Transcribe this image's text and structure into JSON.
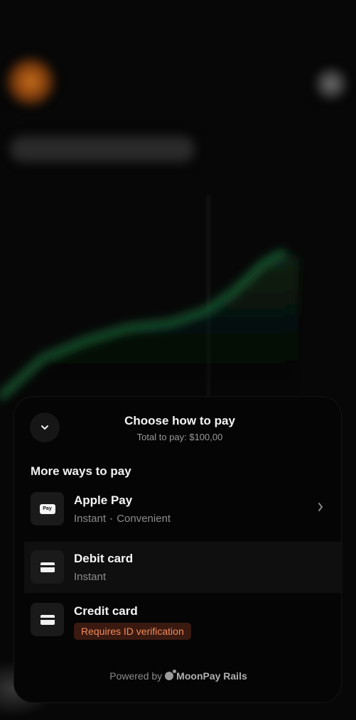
{
  "sheet": {
    "title": "Choose how to pay",
    "subtitle": "Total to pay: $100,00",
    "section_title": "More ways to pay",
    "options": [
      {
        "label": "Apple Pay",
        "meta_primary": "Instant",
        "meta_separator": "•",
        "meta_secondary": "Convenient",
        "icon": "apple-pay-icon",
        "icon_text": "Pay"
      },
      {
        "label": "Debit card",
        "meta_primary": "Instant",
        "icon": "card-icon"
      },
      {
        "label": "Credit card",
        "badge": "Requires ID verification",
        "icon": "card-icon"
      }
    ],
    "footer": {
      "prefix": "Powered by",
      "brand": "MoonPay Rails"
    }
  },
  "colors": {
    "sheet_bg": "#050505",
    "badge_bg": "#3a1a10",
    "badge_text": "#f08a5a",
    "chart_line": "#1f6b3a"
  }
}
